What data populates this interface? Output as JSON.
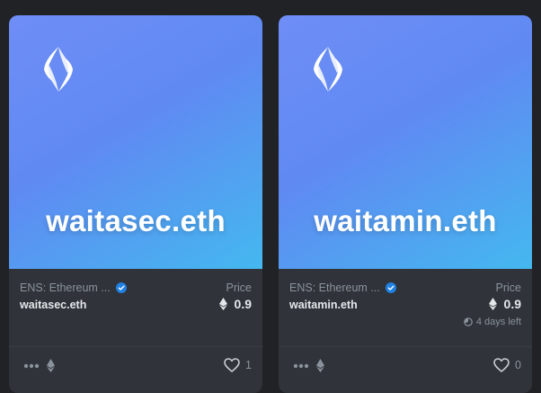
{
  "cards": [
    {
      "art_title": "waitasec.eth",
      "collection": "ENS: Ethereum ...",
      "name": "waitasec.eth",
      "price_label": "Price",
      "price": "0.9",
      "time_left": "",
      "likes": "1"
    },
    {
      "art_title": "waitamin.eth",
      "collection": "ENS: Ethereum ...",
      "name": "waitamin.eth",
      "price_label": "Price",
      "price": "0.9",
      "time_left": "4 days left",
      "likes": "0"
    }
  ],
  "colors": {
    "background": "#202225",
    "card": "#303339",
    "gradient_start": "#6f8df6",
    "gradient_end": "#44b8ef",
    "verified_badge": "#2081e2"
  },
  "icons": [
    "ens-logo-icon",
    "verified-badge-icon",
    "eth-icon",
    "clock-icon",
    "more-icon",
    "heart-icon"
  ]
}
